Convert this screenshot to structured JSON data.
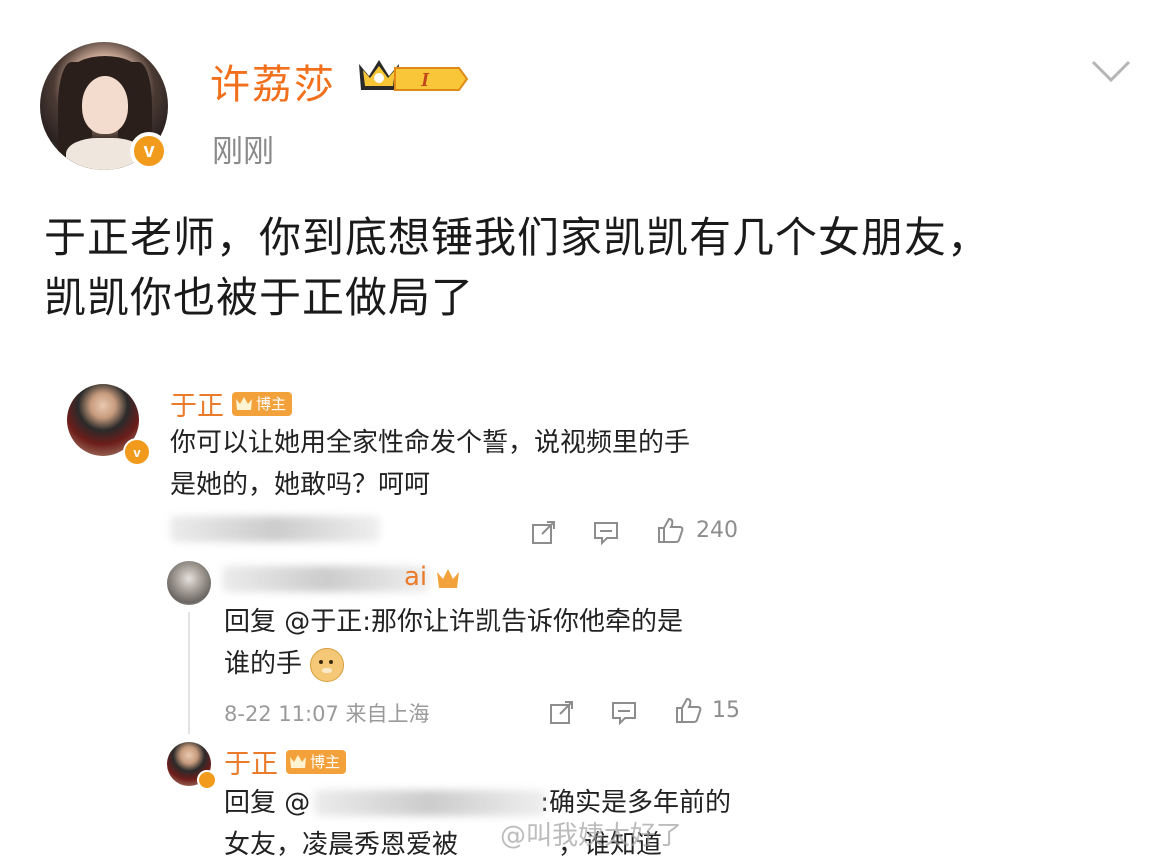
{
  "post": {
    "author": "许荔莎",
    "badge_level": "I",
    "time": "刚刚",
    "text_line1": "于正老师，你到底想锤我们家凯凯有几个女朋友，",
    "text_line2": "凯凯你也被于正做局了"
  },
  "screenshot": {
    "comment1": {
      "name": "于正",
      "tag": "博主",
      "text_line1": "你可以让她用全家性命发个誓，说视频里的手",
      "text_line2": "是她的，她敢吗？呵呵",
      "likes": "240"
    },
    "reply1": {
      "name_visible": "ai",
      "text_line1": "回复 @于正:那你让许凯告诉你他牵的是",
      "text_line2": "谁的手",
      "time": "8-22 11:07",
      "location": "来自上海",
      "likes": "15"
    },
    "reply2": {
      "name": "于正",
      "tag": "博主",
      "text_line1_prefix": "回复 @",
      "text_line1_suffix": ":确实是多年前的",
      "text_line2_a": "女友，凌晨秀恩爱被",
      "text_line2_b": "，谁知道"
    },
    "watermark": "@叫我姨太好了"
  },
  "colors": {
    "accent": "#f26f1c",
    "badge": "#f19a1b",
    "muted": "#8a8a8a"
  },
  "icons": [
    "crown-badge-icon",
    "chevron-down-icon",
    "verified-icon",
    "share-icon",
    "comment-icon",
    "like-icon",
    "doge-emoji-icon"
  ]
}
